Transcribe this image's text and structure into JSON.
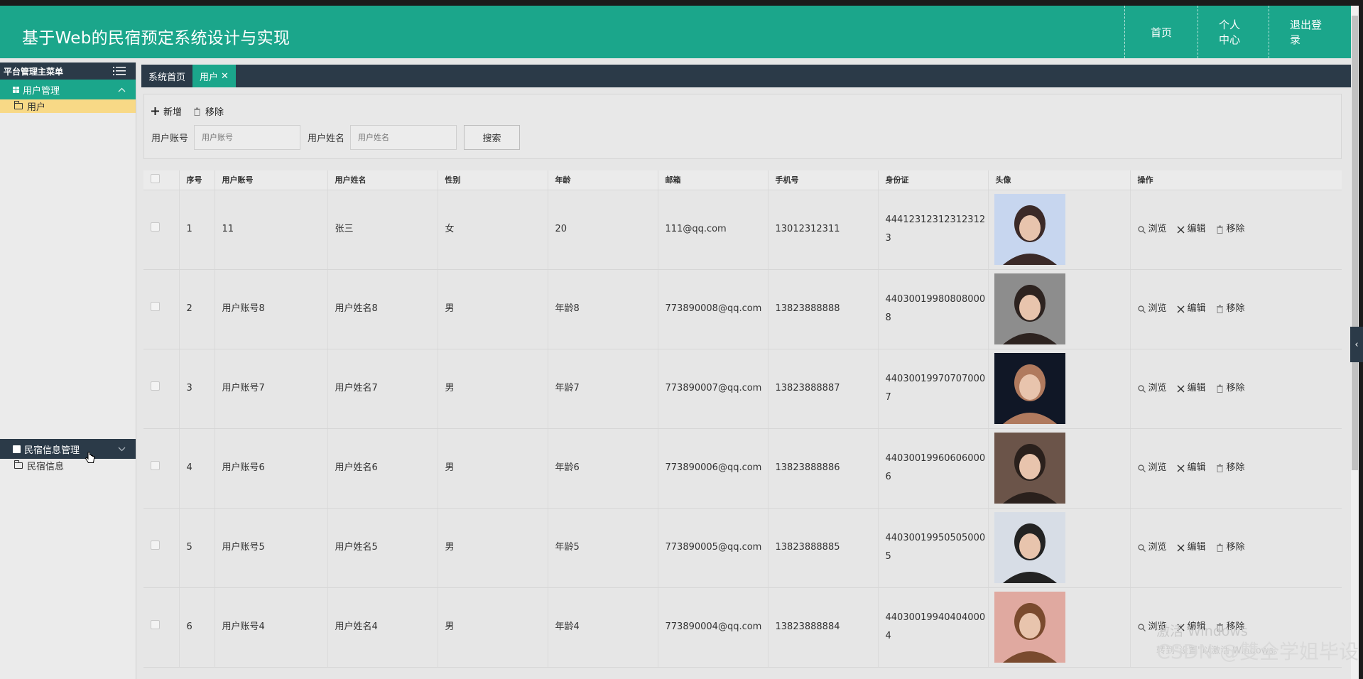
{
  "header": {
    "title": "基于Web的民宿预定系统设计与实现",
    "nav": [
      "首页",
      "个人中心",
      "退出登录"
    ]
  },
  "sidebar": {
    "head": "平台管理主菜单",
    "groups": [
      {
        "label": "用户管理",
        "items": [
          "用户"
        ]
      },
      {
        "label": "民宿信息管理",
        "items": [
          "民宿信息"
        ]
      }
    ]
  },
  "tabs": [
    {
      "label": "系统首页"
    },
    {
      "label": "用户",
      "close": "✕"
    }
  ],
  "toolbar": {
    "add": "新增",
    "remove": "移除"
  },
  "search": {
    "account_label": "用户账号",
    "account_placeholder": "用户账号",
    "name_label": "用户姓名",
    "name_placeholder": "用户姓名",
    "button": "搜索"
  },
  "table": {
    "headers": [
      "",
      "序号",
      "用户账号",
      "用户姓名",
      "性别",
      "年龄",
      "邮箱",
      "手机号",
      "身份证",
      "头像",
      "操作"
    ],
    "ops": {
      "view": "浏览",
      "edit": "编辑",
      "remove": "移除"
    },
    "rows": [
      {
        "no": "1",
        "account": "11",
        "name": "张三",
        "gender": "女",
        "age": "20",
        "email": "111@qq.com",
        "phone": "13012312311",
        "idcard": "444123123123123123",
        "avatar_colors": [
          "#c7d6ef",
          "#3b2a28"
        ]
      },
      {
        "no": "2",
        "account": "用户账号8",
        "name": "用户姓名8",
        "gender": "男",
        "age": "年龄8",
        "email": "773890008@qq.com",
        "phone": "13823888888",
        "idcard": "440300199808080008",
        "avatar_colors": [
          "#8d8d8d",
          "#2d2320"
        ]
      },
      {
        "no": "3",
        "account": "用户账号7",
        "name": "用户姓名7",
        "gender": "男",
        "age": "年龄7",
        "email": "773890007@qq.com",
        "phone": "13823888887",
        "idcard": "440300199707070007",
        "avatar_colors": [
          "#101726",
          "#b07a5e"
        ]
      },
      {
        "no": "4",
        "account": "用户账号6",
        "name": "用户姓名6",
        "gender": "男",
        "age": "年龄6",
        "email": "773890006@qq.com",
        "phone": "13823888886",
        "idcard": "440300199606060006",
        "avatar_colors": [
          "#6b5449",
          "#2a201c"
        ]
      },
      {
        "no": "5",
        "account": "用户账号5",
        "name": "用户姓名5",
        "gender": "男",
        "age": "年龄5",
        "email": "773890005@qq.com",
        "phone": "13823888885",
        "idcard": "440300199505050005",
        "avatar_colors": [
          "#d7dde6",
          "#232323"
        ]
      },
      {
        "no": "6",
        "account": "用户账号4",
        "name": "用户姓名4",
        "gender": "男",
        "age": "年龄4",
        "email": "773890004@qq.com",
        "phone": "13823888884",
        "idcard": "440300199404040004",
        "avatar_colors": [
          "#e0a9a0",
          "#7a4a2e"
        ]
      }
    ]
  },
  "watermark": {
    "line1": "激活 Windows",
    "line2": "转到\"设置\"以激活 Windows。"
  },
  "csdn": "CSDN @雙全学姐毕设"
}
